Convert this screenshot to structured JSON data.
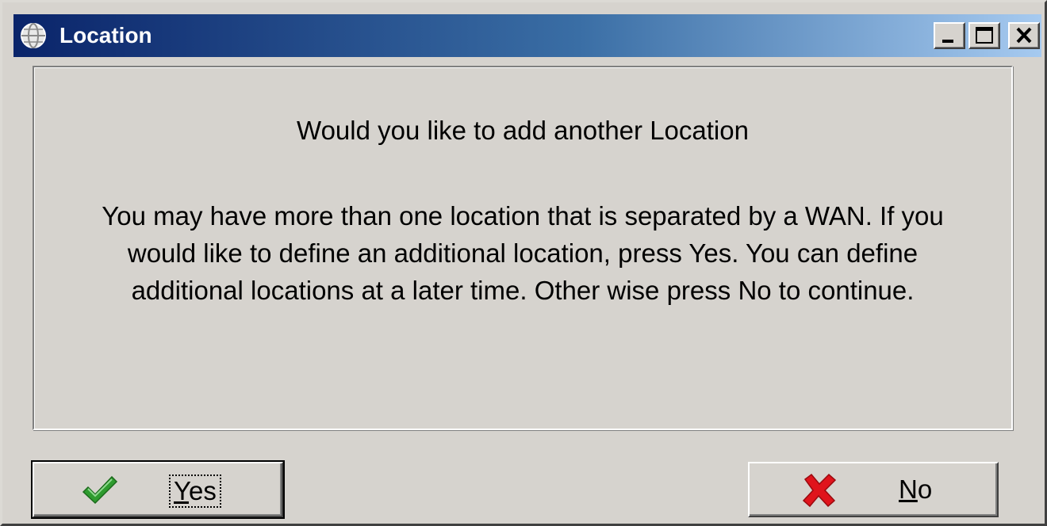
{
  "window": {
    "title": "Location",
    "title_icon": "globe-icon",
    "controls": {
      "minimize_icon": "minimize-icon",
      "maximize_icon": "maximize-icon",
      "close_icon": "close-icon"
    }
  },
  "dialog": {
    "heading": "Would you like to add another Location",
    "message_lines": [
      "You may have more than one location that is separated by a WAN.  If you",
      "would like to define an additional location, press Yes.  You can define",
      "additional locations at a later time.  Other wise press No to continue."
    ]
  },
  "buttons": {
    "yes": {
      "mnemonic": "Y",
      "rest": "es",
      "icon": "checkmark-icon",
      "icon_color": "#2e9b2e"
    },
    "no": {
      "mnemonic": "N",
      "rest": "o",
      "icon": "x-icon",
      "icon_color": "#e0141c"
    }
  },
  "colors": {
    "titlebar_start": "#0a246a",
    "titlebar_end": "#a6caf0",
    "face": "#d6d3ce"
  }
}
